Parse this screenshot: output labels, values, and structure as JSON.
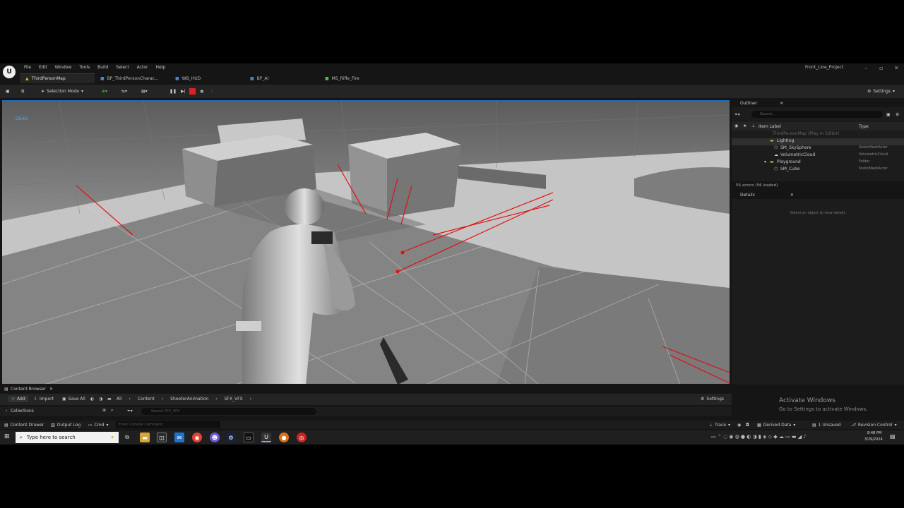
{
  "menubar": {
    "logo": "U",
    "items": [
      "File",
      "Edit",
      "Window",
      "Tools",
      "Build",
      "Select",
      "Actor",
      "Help"
    ],
    "project_name": "Front_Line_Project"
  },
  "tabs": [
    {
      "label": "ThirdPersonMap",
      "icon": "map-icon"
    },
    {
      "label": "BP_ThirdPersonCharac...",
      "icon": "blueprint-icon"
    },
    {
      "label": "WB_HUD",
      "icon": "widget-icon"
    },
    {
      "label": "BP_AI",
      "icon": "blueprint-icon"
    },
    {
      "label": "MS_Rifle_Fire",
      "icon": "sound-icon"
    }
  ],
  "toolbar": {
    "selection_mode": "Selection Mode",
    "settings": "Settings"
  },
  "viewport": {
    "status_text": "DEAD"
  },
  "outliner": {
    "title": "Outliner",
    "search_placeholder": "Search...",
    "col_label": "Item Label",
    "col_type": "Type",
    "rows": [
      {
        "label": "ThirdPersonMap (Play In Editor)",
        "type": ""
      },
      {
        "label": "Lighting",
        "type": ""
      },
      {
        "label": "SM_SkySphere",
        "type": "StaticMeshActor"
      },
      {
        "label": "VolumetricCloud",
        "type": "VolumetricCloud"
      },
      {
        "label": "Playground",
        "type": "Folder"
      },
      {
        "label": "SM_Cube",
        "type": "StaticMeshActor"
      }
    ],
    "status": "56 actors (56 loaded)"
  },
  "details": {
    "title": "Details",
    "hint": "Select an object to view details"
  },
  "content_browser": {
    "tab": "Content Browser",
    "add": "Add",
    "import": "Import",
    "save_all": "Save All",
    "breadcrumb": [
      "All",
      "Content",
      "ShooterAnimation",
      "SFX_VFX"
    ],
    "settings": "Settings",
    "collections": "Collections",
    "search_placeholder": "Search SFX_VFX"
  },
  "statusbar": {
    "content_drawer": "Content Drawer",
    "output_log": "Output Log",
    "cmd": "Cmd",
    "console_placeholder": "Enter Console Command",
    "trace": "Trace",
    "derived_data": "Derived Data",
    "unsaved": "1 Unsaved",
    "revision_control": "Revision Control"
  },
  "watermark": {
    "line1": "Activate Windows",
    "line2": "Go to Settings to activate Windows."
  },
  "taskbar": {
    "search_placeholder": "Type here to search",
    "time": "8:48 PM",
    "date": "3/29/2024"
  }
}
